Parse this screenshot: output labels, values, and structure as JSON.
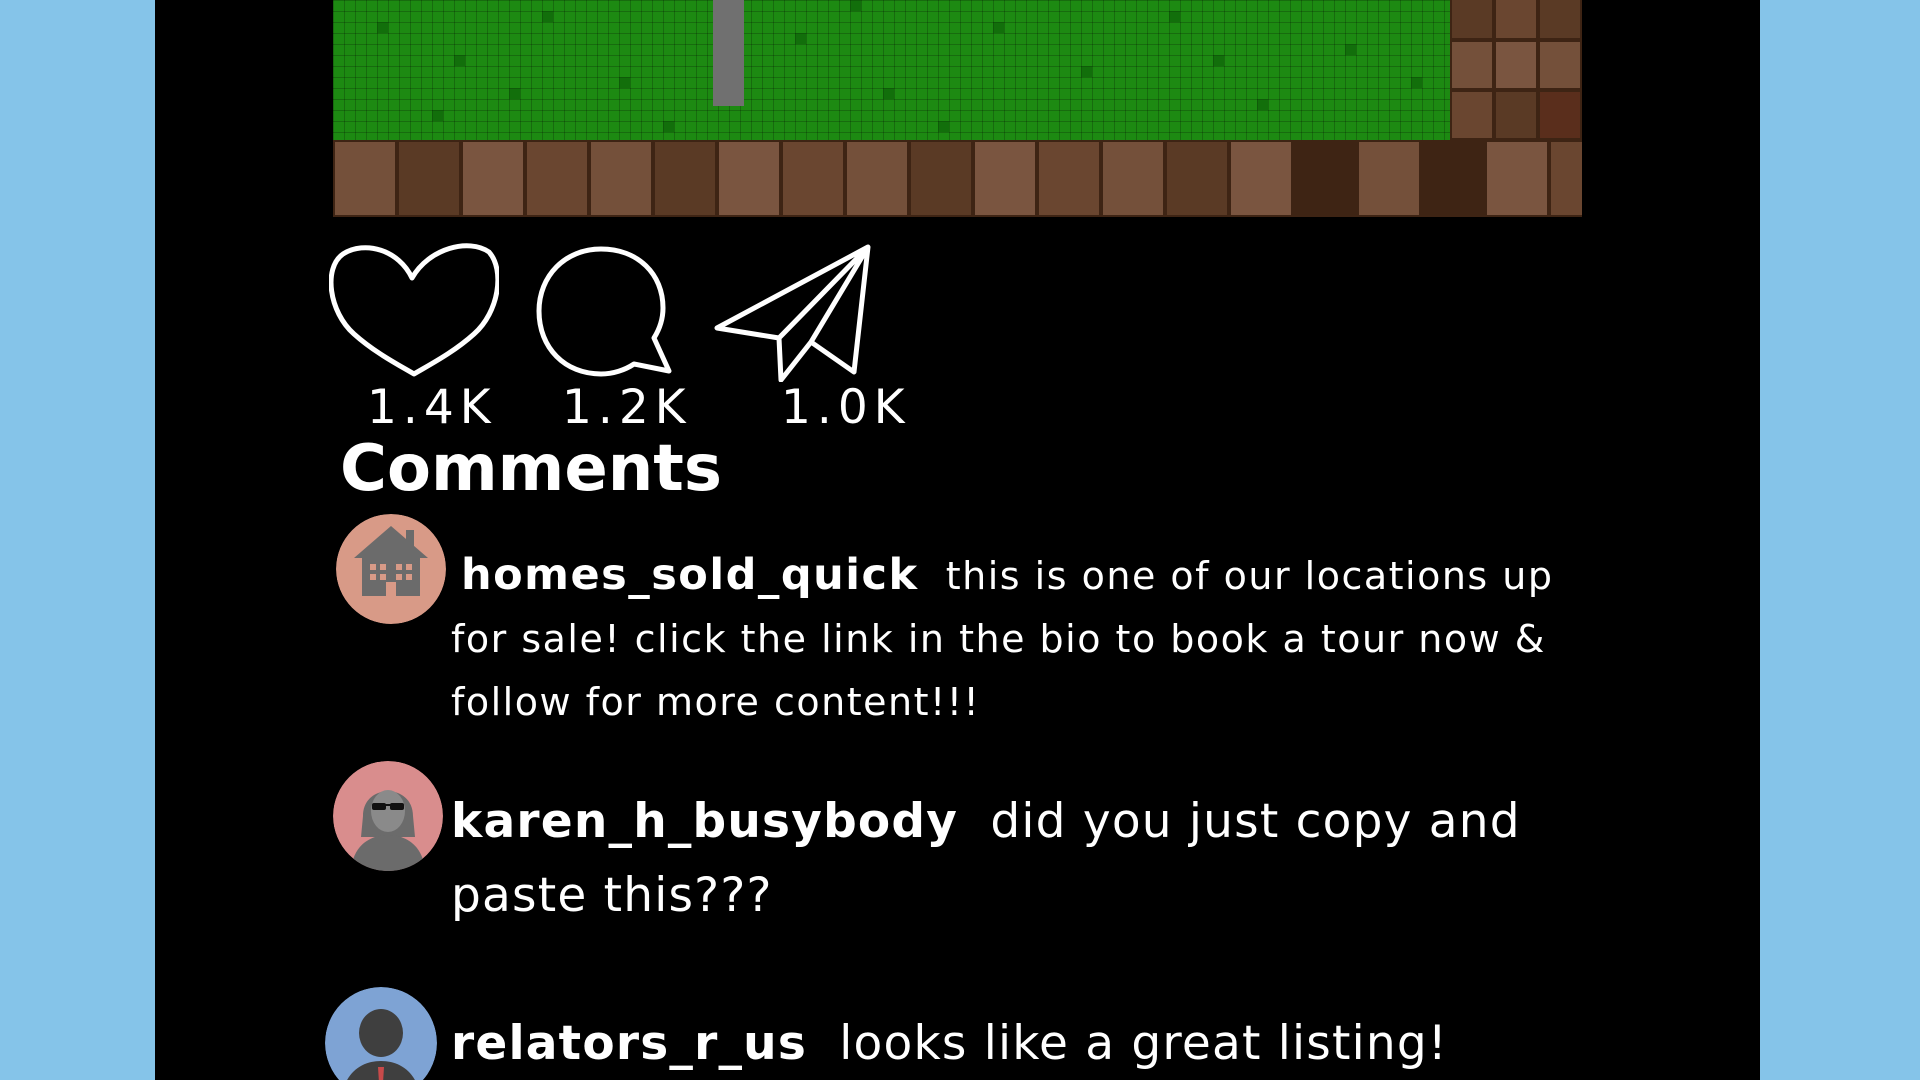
{
  "post": {
    "image_description_icon": "game-tile-scene",
    "actions": {
      "like": {
        "icon": "heart-icon",
        "count": "1.4K"
      },
      "comment": {
        "icon": "speech-bubble-icon",
        "count": "1.2K"
      },
      "share": {
        "icon": "paper-plane-icon",
        "count": "1.0K"
      }
    }
  },
  "comments_title": "Comments",
  "comments": [
    {
      "username": "homes_sold_quick",
      "avatar_icon": "house-avatar-icon",
      "avatar_color": "#d89a87",
      "text": "this is one of our locations up for sale! click the link in the bio to book a tour now & follow for more content!!!"
    },
    {
      "username": "karen_h_busybody",
      "avatar_icon": "woman-sunglasses-avatar-icon",
      "avatar_color": "#d98d8d",
      "text": "did you just copy and paste this???"
    },
    {
      "username": "relators_r_us",
      "avatar_icon": "person-avatar-icon",
      "avatar_color": "#7ea3d4",
      "text": "looks like a great listing!"
    }
  ],
  "colors": {
    "background": "#85c4e9",
    "panel": "#000000",
    "grass": "#1d8a12",
    "dirt": "#6e4a32",
    "text": "#ffffff"
  }
}
